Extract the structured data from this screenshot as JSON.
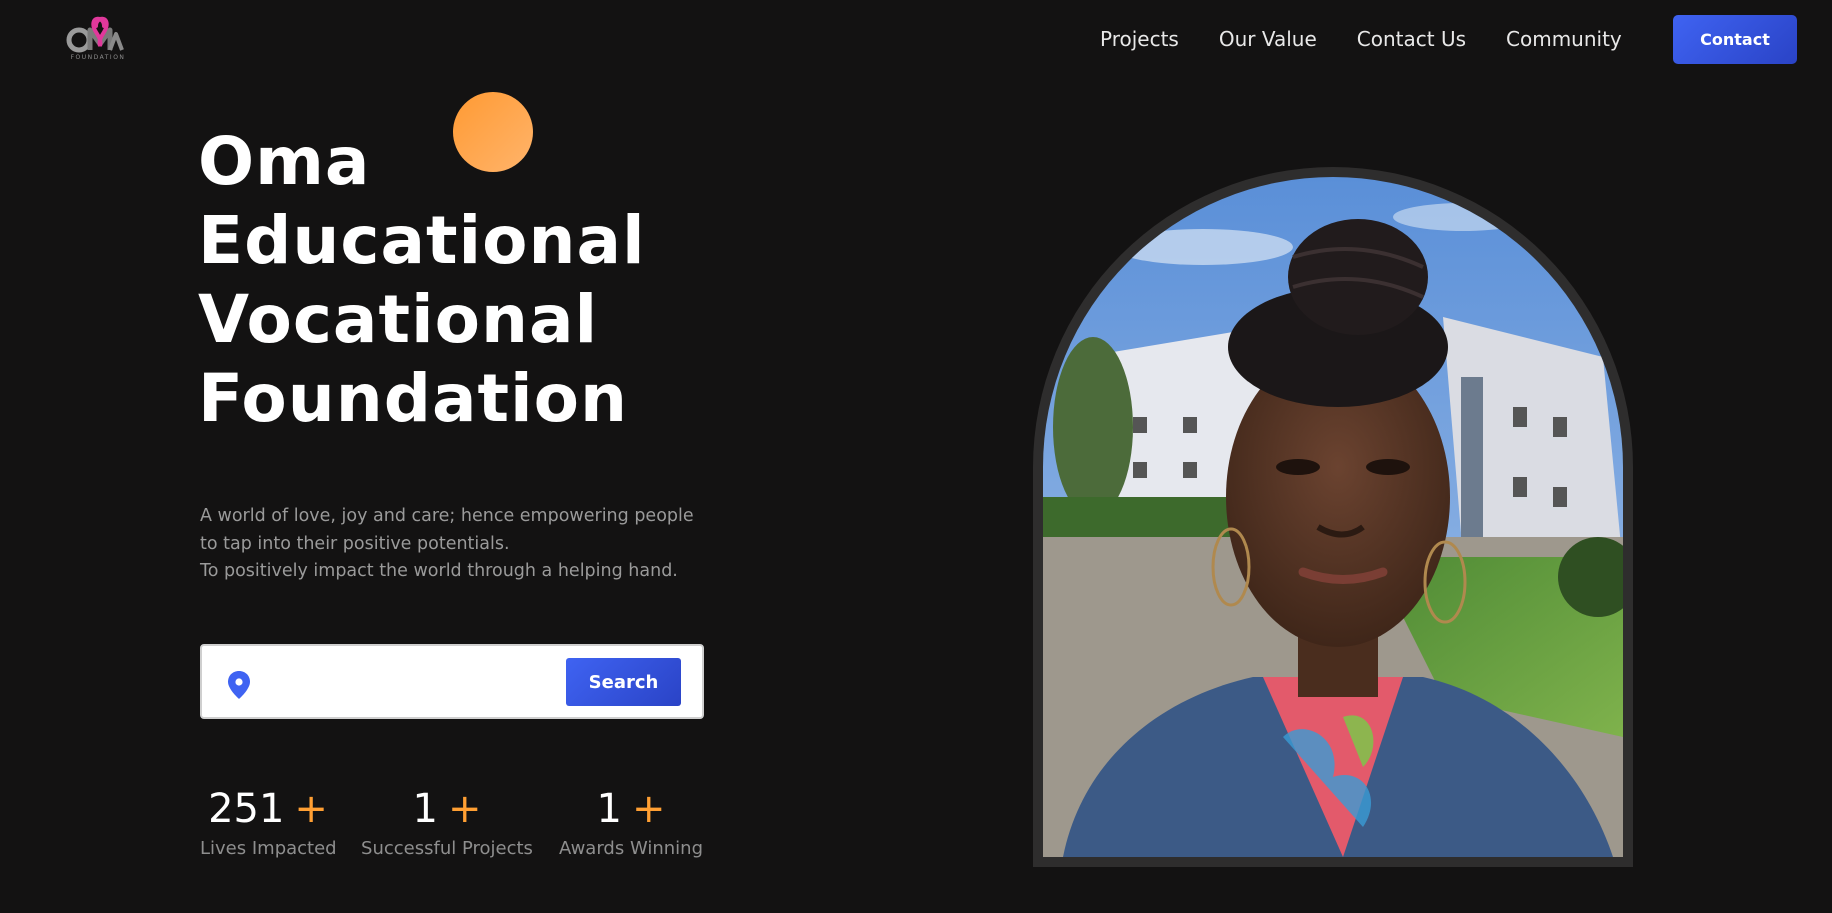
{
  "brand": {
    "logo_icon": "oma-foundation-logo",
    "logo_sub": "FOUNDATION"
  },
  "nav": {
    "items": [
      {
        "label": "Projects"
      },
      {
        "label": "Our Value"
      },
      {
        "label": "Contact Us"
      },
      {
        "label": "Community"
      }
    ],
    "contact_label": "Contact"
  },
  "hero": {
    "title_lines": [
      "Oma",
      "Educational",
      "Vocational",
      "Foundation"
    ],
    "tagline_lines": [
      "A world of love, joy and care; hence empowering people",
      "to tap into their positive potentials.",
      "To positively impact the world through a helping hand."
    ]
  },
  "search": {
    "icon": "location-pin-icon",
    "value": "",
    "button_label": "Search"
  },
  "stats": [
    {
      "value": "251",
      "suffix": "+",
      "label": "Lives Impacted"
    },
    {
      "value": "1",
      "suffix": "+",
      "label": "Successful Projects"
    },
    {
      "value": "1",
      "suffix": "+",
      "label": "Awards Winning"
    }
  ],
  "colors": {
    "background": "#131212",
    "accent": "#3f63f2",
    "orange": "#ff9f33",
    "muted_text": "#9a9a9a"
  }
}
